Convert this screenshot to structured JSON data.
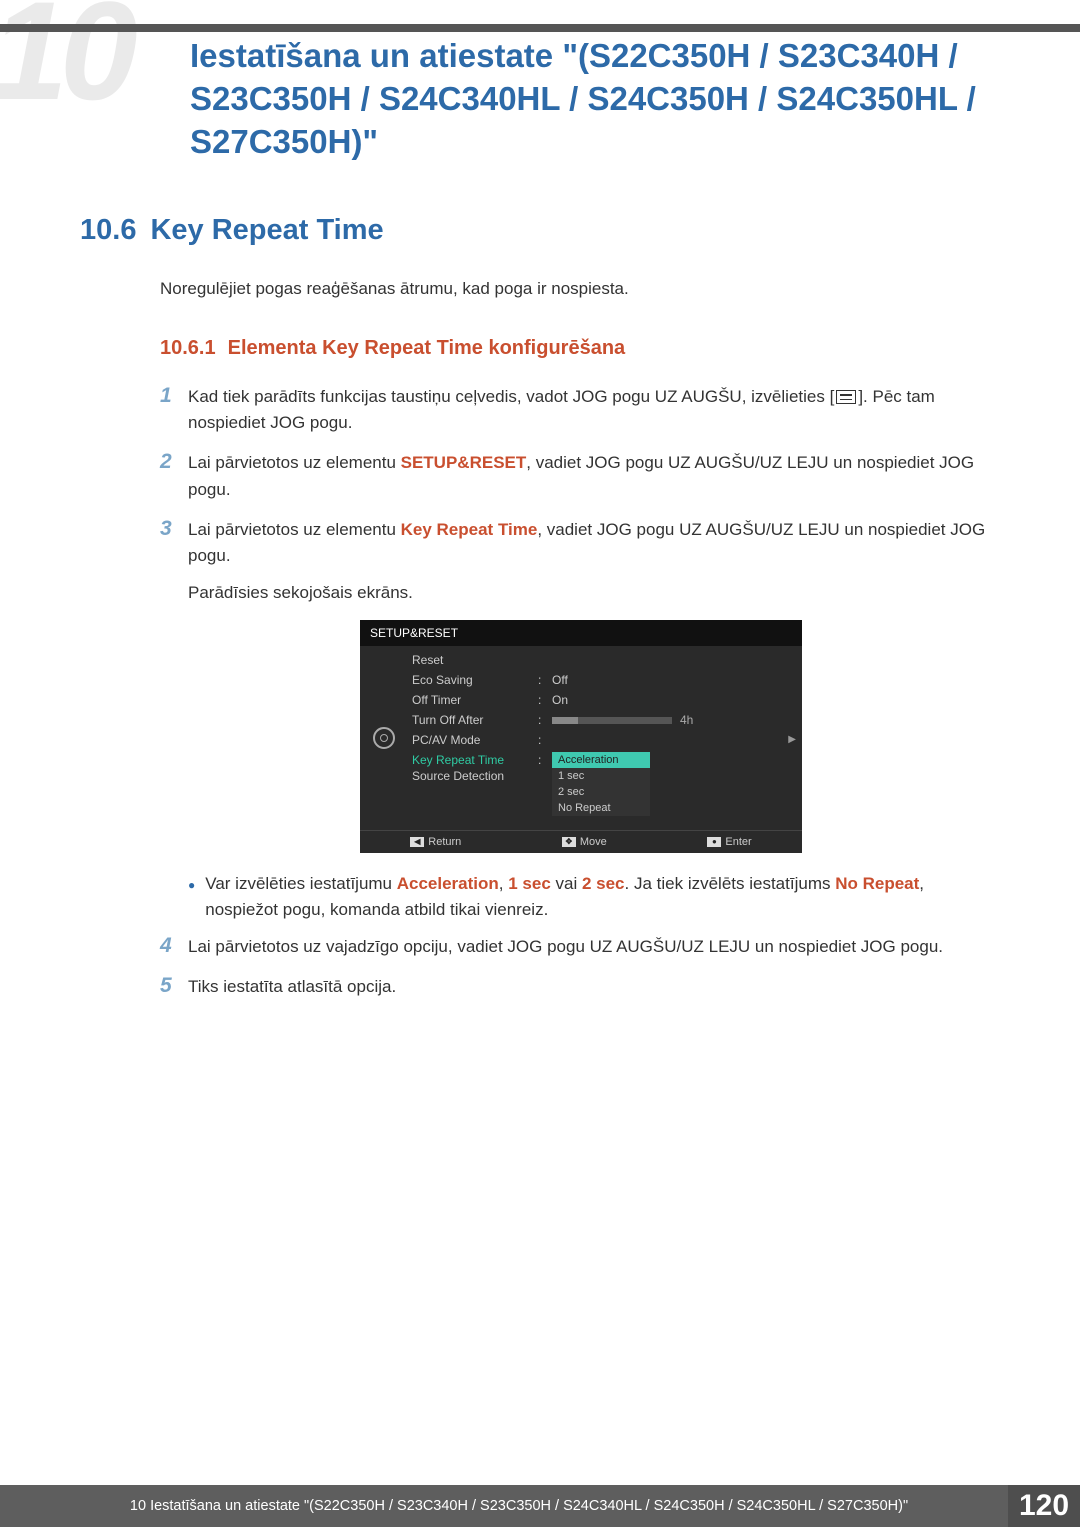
{
  "bg_num": "10",
  "chapter_title": "Iestatīšana un atiestate \"(S22C350H / S23C340H / S23C350H / S24C340HL / S24C350H / S24C350HL / S27C350H)\"",
  "section": {
    "num": "10.6",
    "title": "Key Repeat Time"
  },
  "intro": "Noregulējiet pogas reaģēšanas ātrumu, kad poga ir nospiesta.",
  "subsection": {
    "num": "10.6.1",
    "title": "Elementa Key Repeat Time konfigurēšana"
  },
  "steps": {
    "s1a": "Kad tiek parādīts funkcijas taustiņu ceļvedis, vadot JOG pogu UZ AUGŠU, izvēlieties [",
    "s1b": "]. Pēc tam nospiediet JOG pogu.",
    "s2a": "Lai pārvietotos uz elementu ",
    "s2b": "SETUP&RESET",
    "s2c": ", vadiet JOG pogu UZ AUGŠU/UZ LEJU un nospiediet JOG pogu.",
    "s3a": "Lai pārvietotos uz elementu ",
    "s3b": "Key Repeat Time",
    "s3c": ", vadiet JOG pogu UZ AUGŠU/UZ LEJU un nospiediet JOG pogu.",
    "s3d": "Parādīsies sekojošais ekrāns.",
    "bul_a": "Var izvēlēties iestatījumu ",
    "bul_b": "Acceleration",
    "bul_c": ", ",
    "bul_d": "1 sec",
    "bul_e": " vai ",
    "bul_f": "2 sec",
    "bul_g": ". Ja tiek izvēlēts iestatījums ",
    "bul_h": "No Repeat",
    "bul_i": ", nospiežot pogu, komanda atbild tikai vienreiz.",
    "s4": "Lai pārvietotos uz vajadzīgo opciju, vadiet JOG pogu UZ AUGŠU/UZ LEJU un nospiediet JOG pogu.",
    "s5": "Tiks iestatīta atlasītā opcija."
  },
  "osd": {
    "title": "SETUP&RESET",
    "rows": {
      "reset": "Reset",
      "eco": "Eco Saving",
      "eco_v": "Off",
      "off_timer": "Off Timer",
      "off_timer_v": "On",
      "turn_off": "Turn Off After",
      "turn_off_v": "4h",
      "pcav": "PC/AV Mode",
      "krt": "Key Repeat Time",
      "src": "Source Detection"
    },
    "dropdown": [
      "Acceleration",
      "1 sec",
      "2 sec",
      "No Repeat"
    ],
    "footer": {
      "return": "Return",
      "move": "Move",
      "enter": "Enter"
    }
  },
  "footer": {
    "text": "10 Iestatīšana un atiestate \"(S22C350H / S23C340H / S23C350H / S24C340HL / S24C350H / S24C350HL / S27C350H)\"",
    "page": "120"
  }
}
